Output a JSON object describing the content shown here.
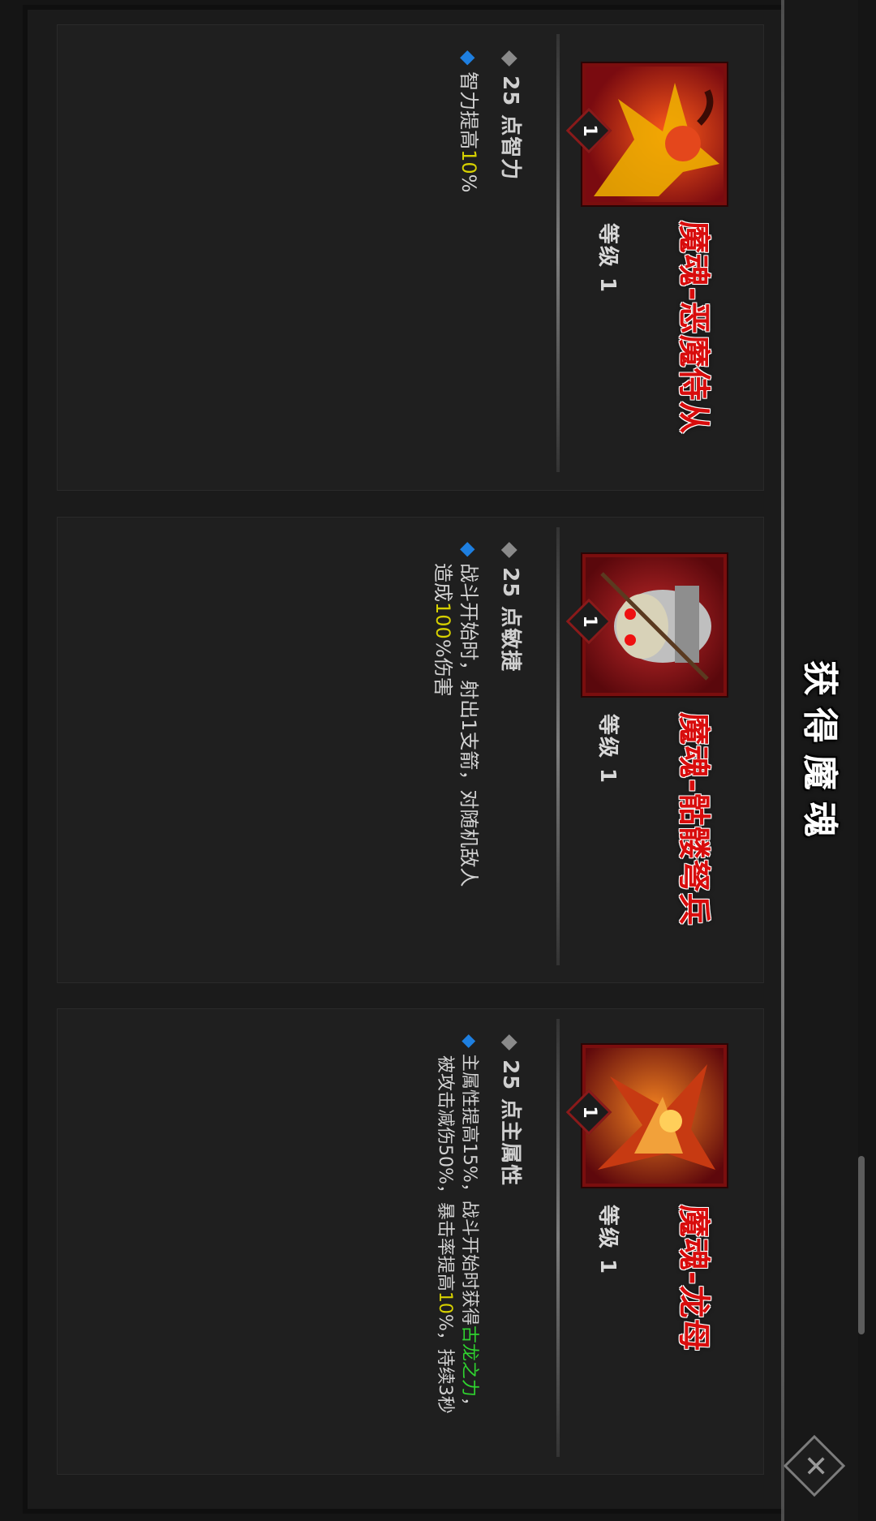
{
  "title": "获得魔魂",
  "close_icon": "✕",
  "cards": [
    {
      "name": "魔魂-恶魔侍从",
      "level": "等级 1",
      "badge": "1",
      "stat": "25 点智力",
      "desc_parts": [
        "智力提高",
        "10",
        "%"
      ],
      "portrait_colors": [
        "#b7131a",
        "#f0b400"
      ]
    },
    {
      "name": "魔魂-骷髅弩兵",
      "level": "等级 1",
      "badge": "1",
      "stat": "25 点敏捷",
      "desc_line1": "战斗开始时，射出1支箭，对随机敌人",
      "desc_line2_parts": [
        "造成",
        "100",
        "%伤害"
      ],
      "portrait_colors": [
        "#9a1419",
        "#c9c2a8"
      ]
    },
    {
      "name": "魔魂-龙母",
      "level": "等级 1",
      "badge": "1",
      "stat": "25 点主属性",
      "desc_line1_parts": [
        "主属性提高15%，战斗开始时获得",
        "古龙之力",
        "，"
      ],
      "desc_line2_parts": [
        "被攻击减伤50%，暴击率提高",
        "10",
        "%，持续3秒"
      ],
      "portrait_colors": [
        "#a3141a",
        "#e66a10"
      ]
    }
  ],
  "colors": {
    "name_red": "#d80c0c",
    "highlight_yellow": "#d6d000",
    "highlight_green": "#2fd22f",
    "blue_bullet": "#1e7fe0"
  }
}
